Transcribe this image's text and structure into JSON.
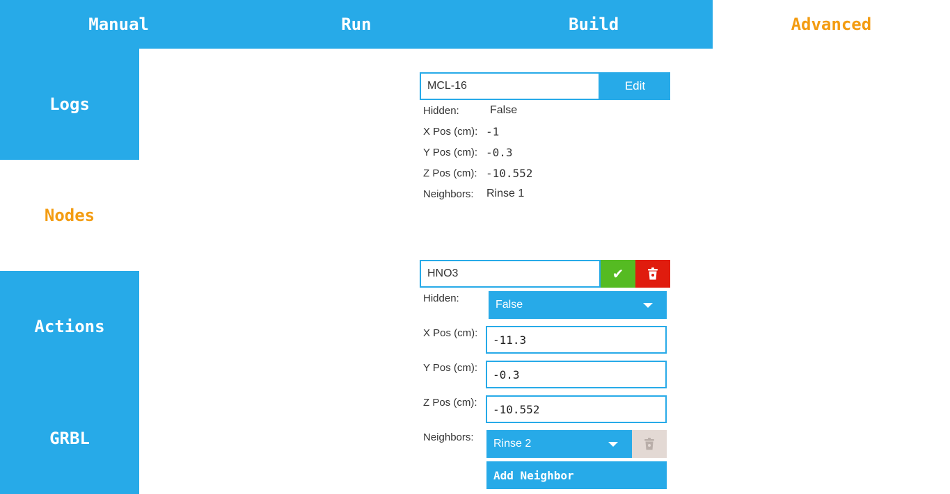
{
  "top_tabs": [
    "Manual",
    "Run",
    "Build",
    "Advanced"
  ],
  "side_tabs": [
    "Logs",
    "Nodes",
    "Actions",
    "GRBL"
  ],
  "node_view": {
    "name": "MCL-16",
    "edit_label": "Edit",
    "hidden_label": "Hidden:",
    "hidden_value": "False",
    "x_label": "X Pos (cm):",
    "x_value": "-1",
    "y_label": "Y Pos (cm):",
    "y_value": "-0.3",
    "z_label": "Z Pos (cm):",
    "z_value": "-10.552",
    "neighbors_label": "Neighbors:",
    "neighbors_value": "Rinse 1"
  },
  "node_edit": {
    "name": "HNO3",
    "hidden_label": "Hidden:",
    "hidden_value": "False",
    "x_label": "X Pos (cm):",
    "x_value": "-11.3",
    "y_label": "Y Pos (cm):",
    "y_value": "-0.3",
    "z_label": "Z Pos (cm):",
    "z_value": "-10.552",
    "neighbors_label": "Neighbors:",
    "neighbor_selected": "Rinse 2",
    "add_neighbor_label": "Add Neighbor"
  },
  "colors": {
    "accent": "#27aae8",
    "active_text": "#f39c12",
    "confirm": "#55bb22",
    "delete": "#e01c0e",
    "disabled": "#e3d9d4"
  }
}
